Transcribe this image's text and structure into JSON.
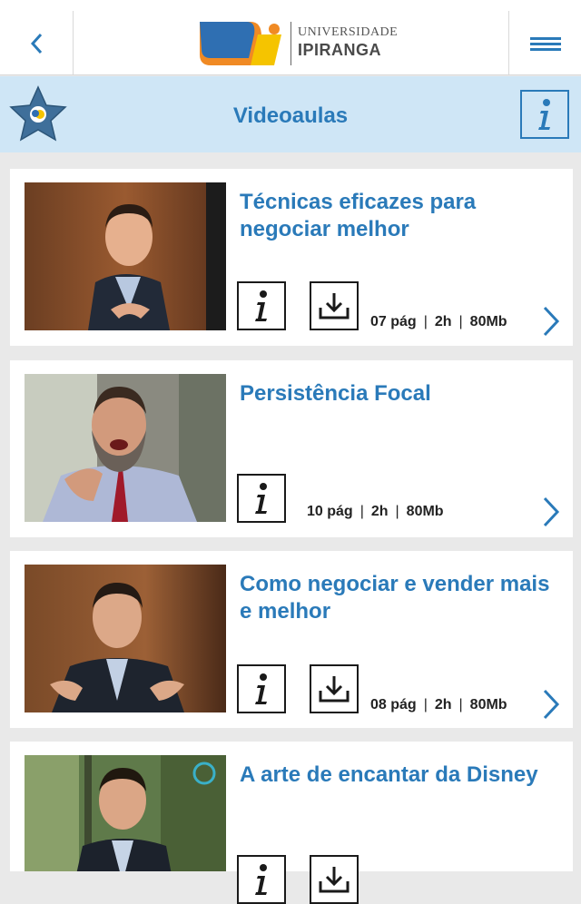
{
  "header": {
    "logo_small": "UNIVERSIDADE",
    "logo_main": "IPIRANGA"
  },
  "titlebar": {
    "title": "Videoaulas"
  },
  "colors": {
    "accent": "#2a7ab9",
    "titlebar_bg": "#cfe6f6",
    "logo_blue": "#2f6fb2",
    "logo_orange": "#f08a24",
    "logo_yellow": "#f5c400"
  },
  "cards": [
    {
      "title": "Técnicas eficazes para negociar melhor",
      "pages": "07 pág",
      "duration": "2h",
      "size": "80Mb",
      "has_download": true
    },
    {
      "title": "Persistência Focal",
      "pages": "10 pág",
      "duration": "2h",
      "size": "80Mb",
      "has_download": false
    },
    {
      "title": "Como negociar e vender mais e melhor",
      "pages": "08 pág",
      "duration": "2h",
      "size": "80Mb",
      "has_download": true
    },
    {
      "title": "A arte de encantar da Disney",
      "has_download": true
    }
  ],
  "icons": {
    "back": "chevron-left-icon",
    "menu": "hamburger-menu-icon",
    "info": "info-icon",
    "download": "download-icon",
    "next": "chevron-right-icon"
  }
}
